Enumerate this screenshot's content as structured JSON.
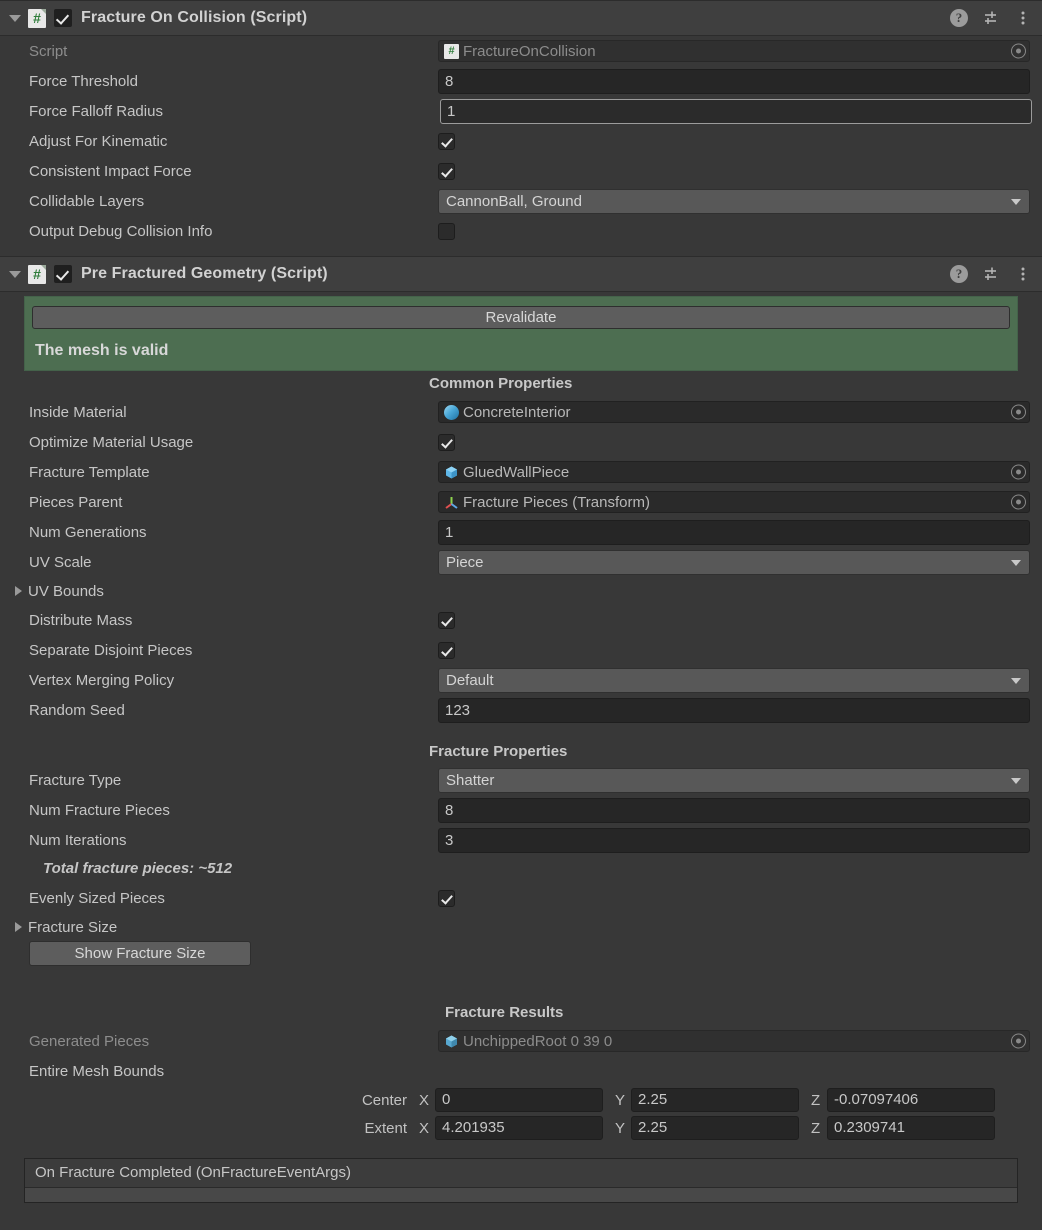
{
  "components": [
    {
      "title": "Fracture On Collision (Script)",
      "enabled": true,
      "icon": "script-icon",
      "help_icon": "help-icon",
      "preset_icon": "preset-icon",
      "menu_icon": "more-menu-icon",
      "fields": [
        {
          "label": "Script",
          "type": "object",
          "value": "FractureOnCollision",
          "icon": "script",
          "dim": true
        },
        {
          "label": "Force Threshold",
          "type": "text",
          "value": "8"
        },
        {
          "label": "Force Falloff Radius",
          "type": "text",
          "value": "1",
          "focused": true
        },
        {
          "label": "Adjust For Kinematic",
          "type": "checkbox",
          "value": true
        },
        {
          "label": "Consistent Impact Force",
          "type": "checkbox",
          "value": true
        },
        {
          "label": "Collidable Layers",
          "type": "popup",
          "value": "CannonBall, Ground"
        },
        {
          "label": "Output Debug Collision Info",
          "type": "checkbox",
          "value": false
        }
      ]
    },
    {
      "title": "Pre Fractured Geometry (Script)",
      "enabled": true,
      "icon": "script-icon",
      "help_icon": "help-icon",
      "preset_icon": "preset-icon",
      "menu_icon": "more-menu-icon",
      "validation": {
        "button_label": "Revalidate",
        "message": "The mesh is valid",
        "background_color": "#4d6e51"
      },
      "sections": [
        {
          "heading": "Common Properties",
          "fields": [
            {
              "label": "Inside Material",
              "type": "object",
              "value": "ConcreteInterior",
              "icon": "material"
            },
            {
              "label": "Optimize Material Usage",
              "type": "checkbox",
              "value": true
            },
            {
              "label": "Fracture Template",
              "type": "object",
              "value": "GluedWallPiece",
              "icon": "prefab"
            },
            {
              "label": "Pieces Parent",
              "type": "object",
              "value": "Fracture Pieces (Transform)",
              "icon": "transform"
            },
            {
              "label": "Num Generations",
              "type": "text",
              "value": "1"
            },
            {
              "label": "UV Scale",
              "type": "popup",
              "value": "Piece"
            },
            {
              "label": "UV Bounds",
              "type": "foldout",
              "expanded": false
            },
            {
              "label": "Distribute Mass",
              "type": "checkbox",
              "value": true
            },
            {
              "label": "Separate Disjoint Pieces",
              "type": "checkbox",
              "value": true
            },
            {
              "label": "Vertex Merging Policy",
              "type": "popup",
              "value": "Default"
            },
            {
              "label": "Random Seed",
              "type": "text",
              "value": "123"
            }
          ]
        },
        {
          "heading": "Fracture Properties",
          "fields": [
            {
              "label": "Fracture Type",
              "type": "popup",
              "value": "Shatter"
            },
            {
              "label": "Num Fracture Pieces",
              "type": "text",
              "value": "8"
            },
            {
              "label": "Num Iterations",
              "type": "text",
              "value": "3"
            },
            {
              "label": "",
              "type": "note",
              "value": "Total fracture pieces:  ~512"
            },
            {
              "label": "Evenly Sized Pieces",
              "type": "checkbox",
              "value": true
            },
            {
              "label": "Fracture Size",
              "type": "foldout",
              "expanded": false
            },
            {
              "label": "",
              "type": "button",
              "value": "Show Fracture Size"
            }
          ]
        },
        {
          "heading": "Fracture Results",
          "fields": [
            {
              "label": "Generated Pieces",
              "type": "object",
              "value": "UnchippedRoot 0 39 0",
              "icon": "gameobject",
              "dim": true
            },
            {
              "label": "Entire Mesh Bounds",
              "type": "label"
            }
          ],
          "bounds": {
            "center": {
              "label": "Center",
              "x_axis": "X",
              "x": "0",
              "y_axis": "Y",
              "y": "2.25",
              "z_axis": "Z",
              "z": "-0.07097406"
            },
            "extent": {
              "label": "Extent",
              "x_axis": "X",
              "x": "4.201935",
              "y_axis": "Y",
              "y": "2.25",
              "z_axis": "Z",
              "z": "0.2309741"
            }
          }
        }
      ],
      "event": {
        "title": "On Fracture Completed (OnFractureEventArgs)"
      }
    }
  ]
}
